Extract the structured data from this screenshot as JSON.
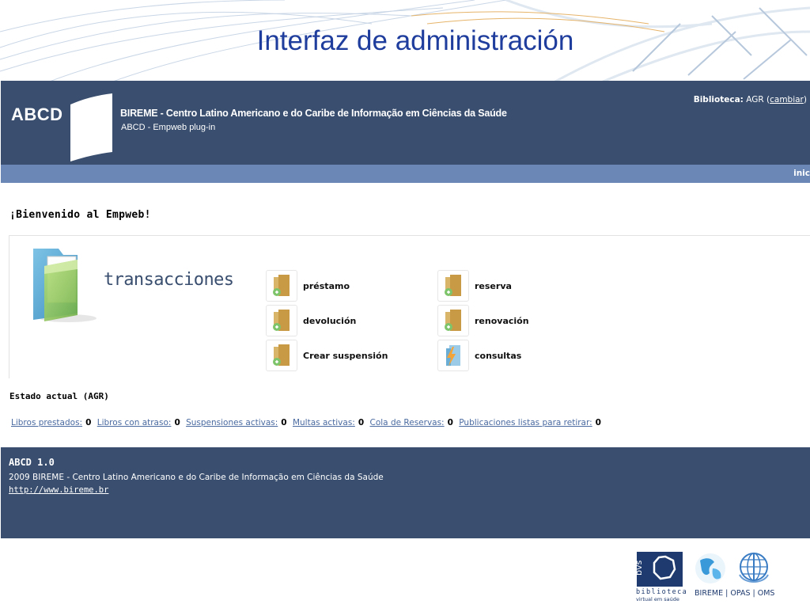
{
  "slide": {
    "title": "Interfaz de administración"
  },
  "header": {
    "logo_text": "ABCD",
    "institution": "BIREME - Centro Latino Americano e do Caribe de Informação em Ciências da Saúde",
    "subtitle": "ABCD - Empweb plug-in",
    "library_label": "Biblioteca:",
    "library_value": "AGR",
    "change_link": "cambiar",
    "nav_home": "inic"
  },
  "main": {
    "welcome": "¡Bienvenido al Empweb!",
    "section_title": "transacciones",
    "actions": [
      {
        "label": "préstamo",
        "icon": "folder-add-icon"
      },
      {
        "label": "reserva",
        "icon": "folder-add-icon"
      },
      {
        "label": "devolución",
        "icon": "folder-add-icon"
      },
      {
        "label": "renovación",
        "icon": "folder-add-icon"
      },
      {
        "label": "Crear suspensión",
        "icon": "folder-add-icon"
      },
      {
        "label": "consultas",
        "icon": "lightning-folder-icon"
      }
    ],
    "status_title": "Estado actual (AGR)",
    "stats": [
      {
        "label": "Libros prestados:",
        "value": "0"
      },
      {
        "label": "Libros con atraso:",
        "value": "0"
      },
      {
        "label": "Suspensiones activas:",
        "value": "0"
      },
      {
        "label": "Multas activas:",
        "value": "0"
      },
      {
        "label": "Cola de Reservas:",
        "value": "0"
      },
      {
        "label": "Publicaciones listas para retirar:",
        "value": "0"
      }
    ]
  },
  "footer": {
    "version": "ABCD 1.0",
    "copyright": "2009 BIREME - Centro Latino Americano e do Caribe de Informação em Ciências da Saúde",
    "url": "http://www.bireme.br"
  },
  "logos": {
    "bvs_text": "bvs",
    "bvs_caption1": "biblioteca",
    "bvs_caption2": "virtual em saúde",
    "partners": "BIREME | OPAS | OMS"
  },
  "colors": {
    "header_bg": "#3a4f6f",
    "nav_bg": "#6b87b6",
    "title_blue": "#1f3d9c",
    "link_blue": "#4a6aa0"
  }
}
